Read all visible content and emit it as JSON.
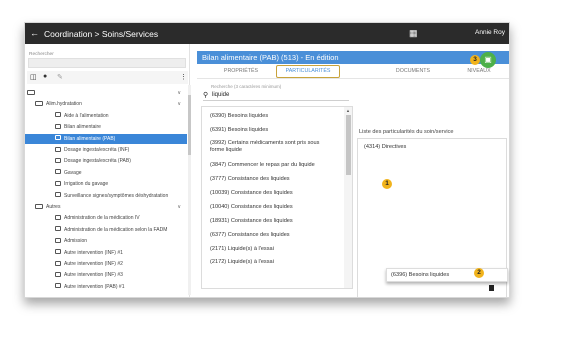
{
  "topbar": {
    "back_icon": "arrow-left-icon",
    "title": "Coordination > Soins/Services",
    "apps_icon": "grid-icon",
    "user": "Annie Roy"
  },
  "sidebar": {
    "search_label": "Rechercher",
    "root_label": "",
    "groups": [
      {
        "label": "Alim.hydratation",
        "items": [
          "Aide à l'alimentation",
          "Bilan alimentaire",
          "Bilan alimentaire (PAB)",
          "Dosage ingesta/excréta (INF)",
          "Dosage ingesta/excréta (PAB)",
          "Gavage",
          "Irrigation du gavage",
          "Surveillance signes/symptômes déshydratation"
        ]
      },
      {
        "label": "Autres",
        "items": [
          "Administration de la médication IV",
          "Administration de la médication selon la FADM",
          "Admission",
          "Autre intervention (INF) #1",
          "Autre intervention (INF) #2",
          "Autre intervention (INF) #3",
          "Autre intervention (PAB) #1",
          "Autre intervention (PAB) #2"
        ]
      }
    ],
    "selected": "Bilan alimentaire (PAB)"
  },
  "main": {
    "title": "Bilan alimentaire (PAB) (513) - En édition",
    "tabs": [
      "PROPRIÉTÉS",
      "PARTICULARITÉS",
      "DOCUMENTS",
      "NIVEAUX"
    ],
    "active_tab": "PARTICULARITÉS",
    "search_label": "Recherche (3 caractères minimum)",
    "search_value": "liquide",
    "results": [
      "(6390) Besoins liquides",
      "(6391) Besoins liquides",
      "(3992) Certains médicaments sont pris sous forme liquide",
      "(3847) Commencer le repas par du liquide",
      "(3777) Consistance des liquides",
      "(10039) Consistance des liquides",
      "(10040) Consistance des liquides",
      "(18931) Consistance des liquides",
      "(6377) Consistance des liquides",
      "(2171) Liquide(s) à l'essai",
      "(2172) Liquide(s) à l'essai"
    ],
    "right_label": "Liste des particularités du soin/service",
    "right_items": [
      "(4314) Directives"
    ],
    "dragged_item": "(6396) Besoins liquides"
  },
  "callouts": [
    "1",
    "2",
    "3"
  ],
  "colors": {
    "header_blue": "#4a8fd8",
    "selected_blue": "#3a86d8",
    "callout": "#f1b31c",
    "save_green": "#4db04a",
    "topbar": "#2b2b2b"
  }
}
